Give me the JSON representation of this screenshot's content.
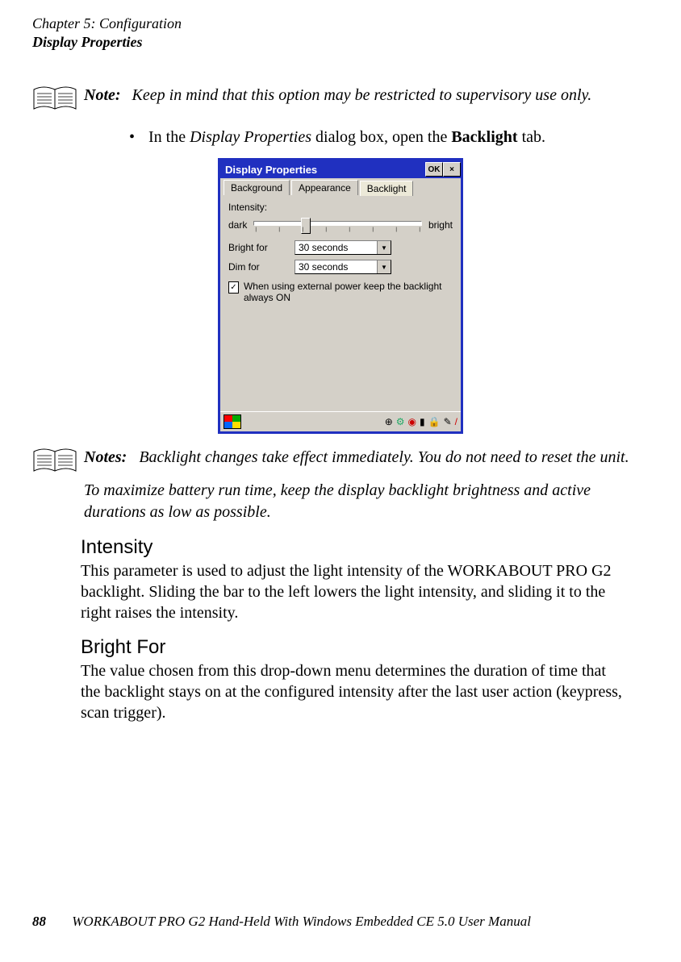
{
  "header": {
    "chapter_line": "Chapter 5: Configuration",
    "section_line": "Display Properties"
  },
  "note1": {
    "label": "Note:",
    "text": "Keep in mind that this option may be restricted to supervisory use only."
  },
  "bullet1": {
    "pre": "In the ",
    "italic": "Display Properties",
    "mid": " dialog box, open the ",
    "bold": "Backlight",
    "post": " tab."
  },
  "dialog": {
    "title": "Display Properties",
    "ok": "OK",
    "close": "×",
    "tabs": {
      "background": "Background",
      "appearance": "Appearance",
      "backlight": "Backlight"
    },
    "intensity_label": "Intensity:",
    "dark": "dark",
    "bright": "bright",
    "bright_for": "Bright for",
    "dim_for": "Dim for",
    "bright_for_val": "30 seconds",
    "dim_for_val": "30 seconds",
    "check_text": "When using external power keep the backlight always ON"
  },
  "notes2": {
    "label": "Notes:",
    "p1": "Backlight changes take effect immediately. You do not need to reset the unit.",
    "p2": "To maximize battery run time, keep the display backlight brightness and active durations as low as possible."
  },
  "sections": {
    "intensity": {
      "heading": "Intensity",
      "body": "This parameter is used to adjust the light intensity of the WORKABOUT PRO G2 backlight. Sliding the bar to the left lowers the light intensity, and sliding it to the right raises the intensity."
    },
    "bright_for": {
      "heading": "Bright For",
      "body": "The value chosen from this drop-down menu determines the duration of time that the backlight stays on at the configured intensity after the last user action (keypress, scan trigger)."
    }
  },
  "footer": {
    "page": "88",
    "title": "WORKABOUT PRO G2 Hand-Held With Windows Embedded CE 5.0 User Manual"
  }
}
